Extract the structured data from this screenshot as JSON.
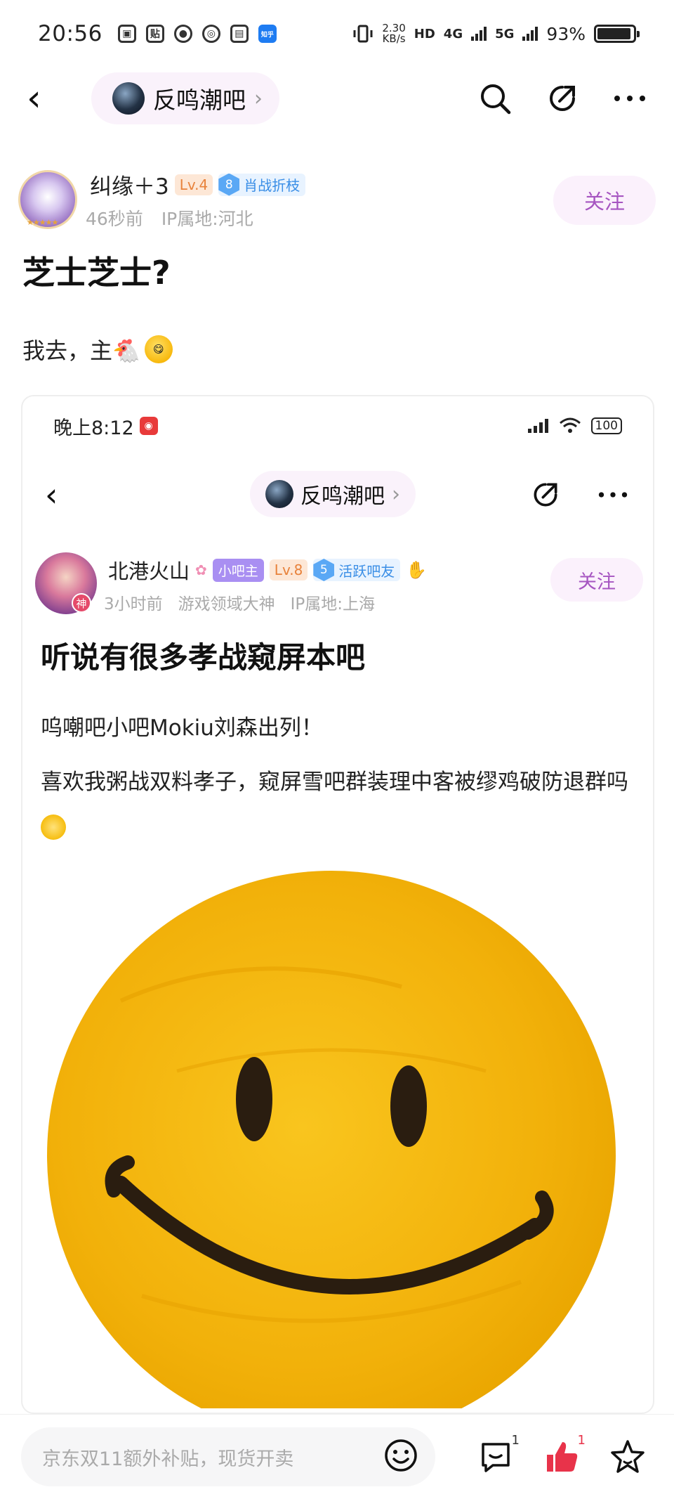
{
  "status_bar": {
    "time": "20:56",
    "net_speed_value": "2.30",
    "net_speed_unit": "KB/s",
    "hd_tag": "HD",
    "net_4g": "4G",
    "net_5g": "5G",
    "battery_pct": "93%",
    "battery_level": 0.93,
    "app_icons": [
      "bilibili-icon",
      "tieba-icon",
      "browser-icon",
      "weibo-icon",
      "note-icon",
      "zhihu-icon"
    ],
    "zhihu_label": "知乎"
  },
  "nav": {
    "forum_name": "反鸣潮吧",
    "chevron": "›"
  },
  "post": {
    "author_name": "纠缘＋3",
    "level": "Lv.4",
    "fan_level": "8",
    "fan_title": "肖战折枝",
    "time_ago": "46秒前",
    "ip_location": "IP属地:河北",
    "follow_label": "关注",
    "title": "芝士芝士?",
    "body": "我去，主🐔"
  },
  "embedded": {
    "status_time": "晚上8:12",
    "battery": "100",
    "forum_name": "反鸣潮吧",
    "author_name": "北港火山",
    "mod_badge": "小吧主",
    "level": "Lv.8",
    "fan_level": "5",
    "fan_title": "活跃吧友",
    "shen_badge": "神",
    "time_ago": "3小时前",
    "title_tag": "游戏领域大神",
    "ip_location": "IP属地:上海",
    "follow_label": "关注",
    "post_title": "听说有很多孝战窥屏本吧",
    "para1": "呜嘲吧小吧Mokiu刘森出列！",
    "para2": "喜欢我粥战双料孝子，窥屏雪吧群装理中客被缪鸡破防退群吗"
  },
  "bottom_bar": {
    "comment_placeholder": "京东双11额外补贴，现货开卖",
    "comment_count": "1",
    "like_count": "1"
  },
  "colors": {
    "accent_purple": "#a655c1",
    "like_red": "#e8334a",
    "smiley_yellow": "#f4b400"
  }
}
